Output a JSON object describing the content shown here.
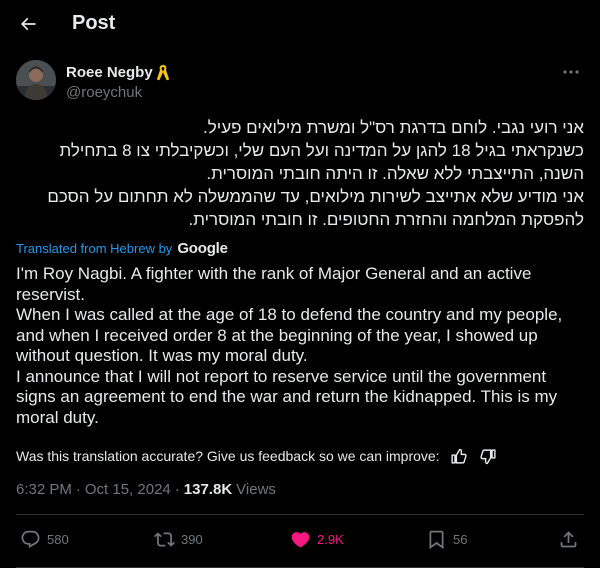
{
  "header": {
    "title": "Post"
  },
  "author": {
    "name": "Roee Negby",
    "handle": "@roeychuk",
    "badge_icon": "yellow-ribbon-icon"
  },
  "original": {
    "lines": [
      "אני רועי נגבי. לוחם בדרגת רס\"ל ומשרת מילואים פעיל.",
      "כשנקראתי בגיל 18 להגן על המדינה ועל העם שלי, וכשקיבלתי צו 8 בתחילת",
      "השנה, התייצבתי ללא שאלה. זו היתה חובתי המוסרית.",
      "אני מודיע שלא אתייצב לשירות מילואים, עד שהממשלה לא תחתום על הסכם",
      "להפסקת המלחמה והחזרת החטופים. זו חובתי המוסרית."
    ]
  },
  "translation": {
    "label": "Translated from Hebrew by",
    "provider": "Google",
    "paragraphs": [
      "I'm Roy Nagbi. A fighter with the rank of Major General and an active reservist.",
      "When I was called at the age of 18 to defend the country and my people, and when I received order 8 at the beginning of the year, I showed up without question. It was my moral duty.",
      "I announce that I will not report to reserve service until the government signs an agreement to end the war and return the kidnapped. This is my moral duty."
    ],
    "feedback_prompt": "Was this translation accurate? Give us feedback so we can improve:"
  },
  "meta": {
    "time": "6:32 PM",
    "date": "Oct 15, 2024",
    "separator": "·",
    "views_count": "137.8K",
    "views_label": "Views"
  },
  "actions": {
    "replies": "580",
    "reposts": "390",
    "likes": "2.9K",
    "bookmarks": "56"
  },
  "colors": {
    "background": "#000000",
    "text": "#e7e9ea",
    "muted": "#71767b",
    "accent": "#1d9bf0",
    "like": "#f91880",
    "divider": "#2f3336",
    "ribbon": "#f5c518"
  }
}
